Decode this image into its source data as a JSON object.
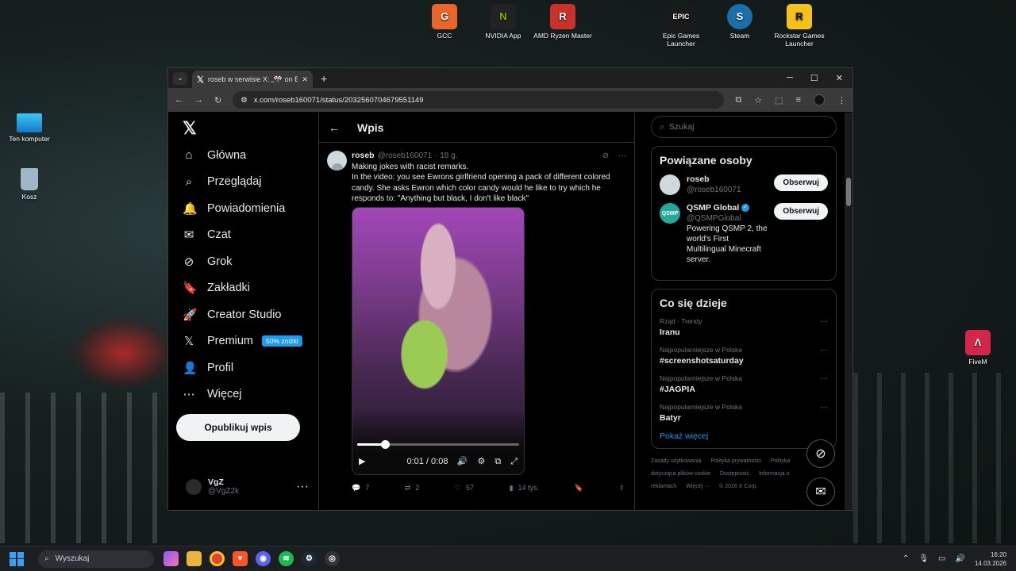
{
  "desktop": {
    "top_icons": [
      {
        "label": "GCC",
        "glyph": "G",
        "color": "#e8662a"
      },
      {
        "label": "NVIDIA App",
        "glyph": "N",
        "color": "#222"
      },
      {
        "label": "AMD Ryzen Master",
        "glyph": "R",
        "color": "#c9312a"
      },
      {
        "label": "Epic Games Launcher",
        "glyph": "EPIC",
        "color": "#1a1a1a"
      },
      {
        "label": "Steam",
        "glyph": "S",
        "color": "#1b6fa8"
      },
      {
        "label": "Rockstar Games Launcher",
        "glyph": "R",
        "color": "#f4c21a"
      }
    ],
    "left_icons": [
      {
        "label": "Ten komputer"
      },
      {
        "label": "Kosz"
      }
    ],
    "right_icon": {
      "label": "FiveM"
    }
  },
  "browser": {
    "tab_title": "roseb w serwisie X: „🎌 on Ewr",
    "url": "x.com/roseb160071/status/2032560704679551149"
  },
  "nav": {
    "items": [
      {
        "label": "Główna",
        "icon": "⌂"
      },
      {
        "label": "Przeglądaj",
        "icon": "⌕"
      },
      {
        "label": "Powiadomienia",
        "icon": "🔔"
      },
      {
        "label": "Czat",
        "icon": "✉"
      },
      {
        "label": "Grok",
        "icon": "⊘"
      },
      {
        "label": "Zakładki",
        "icon": "🔖"
      },
      {
        "label": "Creator Studio",
        "icon": "🚀"
      },
      {
        "label": "Premium",
        "icon": "𝕏"
      },
      {
        "label": "Profil",
        "icon": "👤"
      },
      {
        "label": "Więcej",
        "icon": "⋯"
      }
    ],
    "premium_badge": "50% zniżki",
    "post_button": "Opublikuj wpis",
    "user": {
      "name": "VgZ",
      "handle": "@VgZ2k"
    }
  },
  "main": {
    "header": "Wpis",
    "tweet": {
      "name": "roseb",
      "handle": "@roseb160071",
      "time": "· 18 g.",
      "line1": "Making jokes with racist remarks.",
      "line2": "In the video: you see Ewrons girlfriend opening a pack of different colored candy. She asks Ewron which color candy would he like to try which he responds to: \"Anything but black, I don't like black\"",
      "video_time": "0:01 / 0:08",
      "video_progress": 0.17,
      "stats": {
        "replies": "7",
        "reposts": "2",
        "likes": "57",
        "views": "14 tys."
      }
    }
  },
  "side": {
    "search_placeholder": "Szukaj",
    "related_title": "Powiązane osoby",
    "people": [
      {
        "name": "roseb",
        "handle": "@roseb160071",
        "bio": "",
        "follow": "Obserwuj"
      },
      {
        "name": "QSMP Global",
        "handle": "@QSMPGlobal",
        "bio": "Powering QSMP 2, the world's First Multilingual Minecraft server.",
        "follow": "Obserwuj"
      }
    ],
    "trends_title": "Co się dzieje",
    "trends": [
      {
        "cat": "Rząd · Trendy",
        "name": "Iranu"
      },
      {
        "cat": "Najpopularniejsze w Polska",
        "name": "#screenshotsaturday"
      },
      {
        "cat": "Najpopularniejsze w Polska",
        "name": "#JAGPIA"
      },
      {
        "cat": "Najpopularniejsze w Polska",
        "name": "Batyr"
      }
    ],
    "show_more": "Pokaż więcej",
    "footer": [
      "Zasady użytkowania",
      "Polityka prywatności",
      "Polityka dotycząca plików cookie",
      "Dostępność",
      "Informacja o reklamach",
      "Więcej ···",
      "© 2026 X Corp."
    ]
  },
  "taskbar": {
    "search": "Wyszukaj",
    "time": "16:20",
    "date": "14.03.2026"
  }
}
